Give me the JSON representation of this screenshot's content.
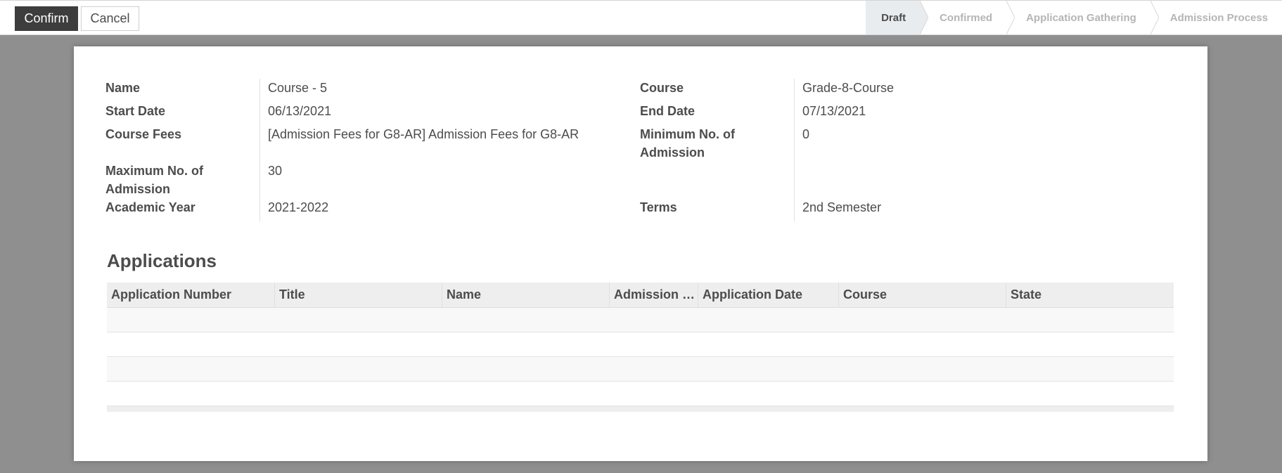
{
  "toolbar": {
    "confirm_label": "Confirm",
    "cancel_label": "Cancel"
  },
  "statusbar": {
    "stages": [
      {
        "label": "Draft",
        "active": true
      },
      {
        "label": "Confirmed",
        "active": false
      },
      {
        "label": "Application Gathering",
        "active": false
      },
      {
        "label": "Admission Process",
        "active": false
      }
    ]
  },
  "form": {
    "left": [
      {
        "label": "Name",
        "value": "Course - 5"
      },
      {
        "label": "Start Date",
        "value": "06/13/2021"
      },
      {
        "label": "Course Fees",
        "value": "[Admission Fees for G8-AR] Admission Fees for G8-AR"
      },
      {
        "label": "Maximum No. of Admission",
        "value": "30"
      },
      {
        "label": "Academic Year",
        "value": "2021-2022"
      }
    ],
    "right": [
      {
        "label": "Course",
        "value": "Grade-8-Course"
      },
      {
        "label": "End Date",
        "value": "07/13/2021"
      },
      {
        "label": "Minimum No. of Admission",
        "value": "0"
      },
      {
        "label": "Terms",
        "value": "2nd Semester"
      }
    ]
  },
  "applications": {
    "title": "Applications",
    "columns": [
      "Application Number",
      "Title",
      "Name",
      "Admission …",
      "Application Date",
      "Course",
      "State"
    ],
    "rows": []
  },
  "colors": {
    "primary_button": "#3d3d3d",
    "backdrop": "#8f8f8f",
    "active_stage": "#e9ecef"
  }
}
